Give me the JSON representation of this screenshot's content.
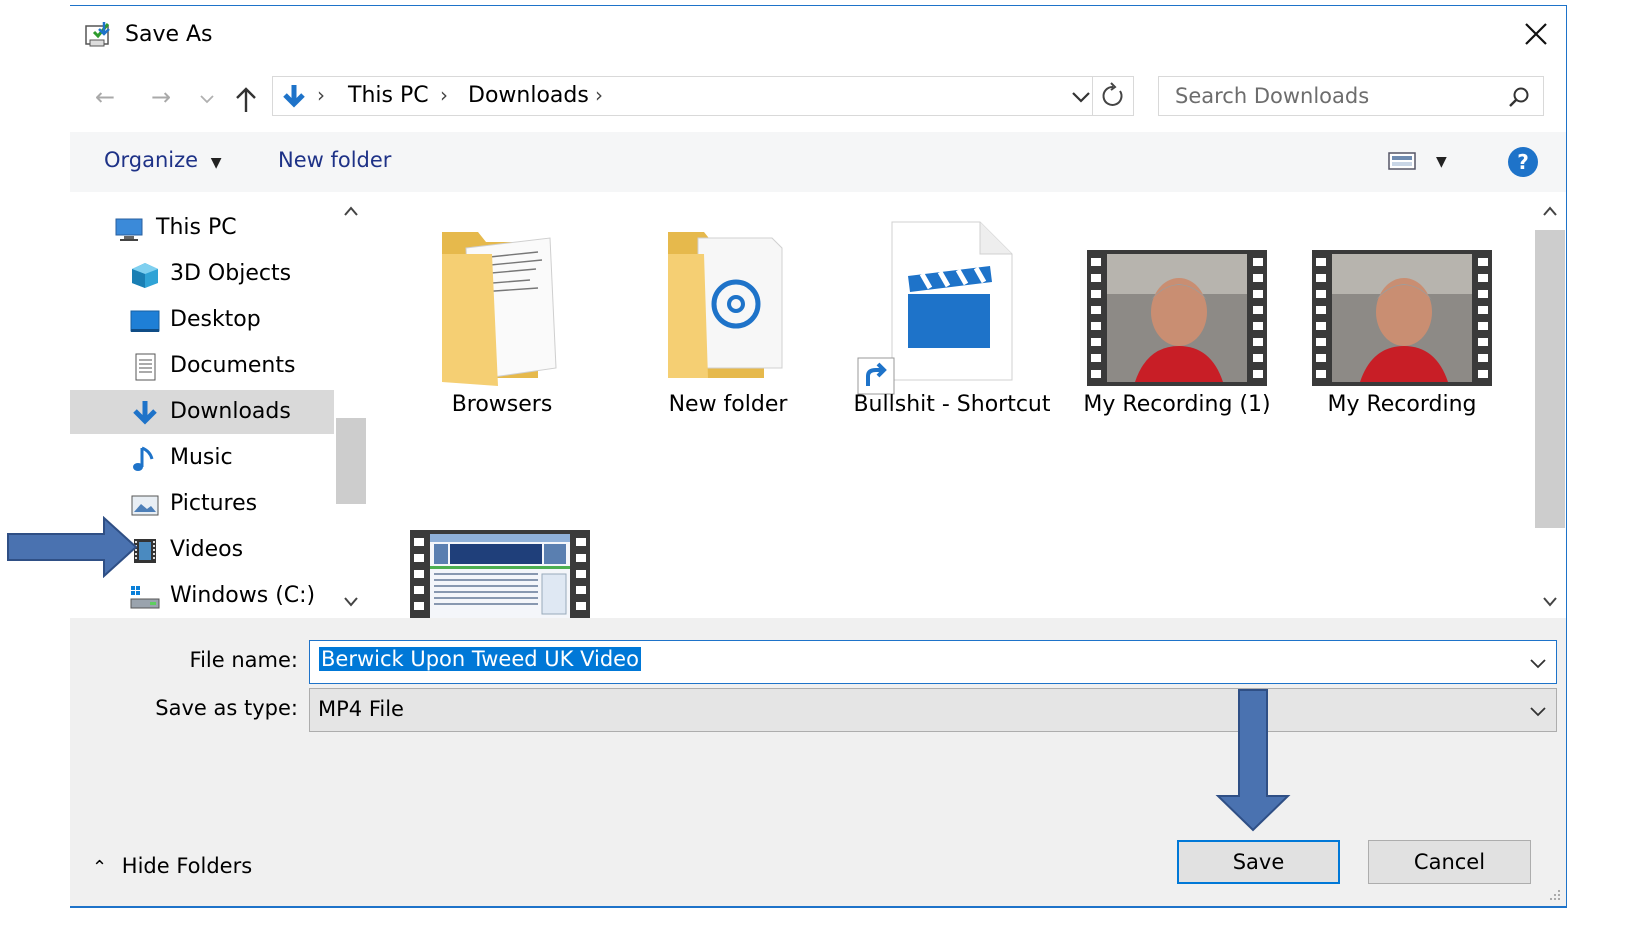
{
  "window": {
    "title": "Save As"
  },
  "address": {
    "crumbs": [
      "This PC",
      "Downloads"
    ],
    "search_placeholder": "Search Downloads"
  },
  "toolbar": {
    "organize_label": "Organize",
    "new_folder_label": "New folder"
  },
  "nav_pane": {
    "items": [
      {
        "label": "This PC",
        "icon": "computer-icon"
      },
      {
        "label": "3D Objects",
        "icon": "3d-objects-icon"
      },
      {
        "label": "Desktop",
        "icon": "desktop-icon"
      },
      {
        "label": "Documents",
        "icon": "documents-icon"
      },
      {
        "label": "Downloads",
        "icon": "downloads-icon",
        "selected": true
      },
      {
        "label": "Music",
        "icon": "music-icon"
      },
      {
        "label": "Pictures",
        "icon": "pictures-icon"
      },
      {
        "label": "Videos",
        "icon": "videos-icon"
      },
      {
        "label": "Windows (C:)",
        "icon": "drive-icon"
      }
    ]
  },
  "files": [
    {
      "name": "Browsers",
      "type": "folder"
    },
    {
      "name": "New folder",
      "type": "folder"
    },
    {
      "name": "Bullshit - Shortcut",
      "type": "video-shortcut"
    },
    {
      "name": "My Recording (1)",
      "type": "video"
    },
    {
      "name": "My Recording",
      "type": "video"
    },
    {
      "name": "",
      "type": "video"
    }
  ],
  "form": {
    "file_name_label": "File name:",
    "file_name_value": "Berwick Upon Tweed UK Video",
    "save_type_label": "Save as type:",
    "save_type_value": "MP4 File"
  },
  "footer": {
    "hide_folders_label": "Hide Folders",
    "save_label": "Save",
    "cancel_label": "Cancel"
  },
  "colors": {
    "accent": "#0078d7",
    "annotation_arrow": "#4a72b0",
    "folder": "#f5cf73",
    "selection": "#d9d9d9"
  }
}
